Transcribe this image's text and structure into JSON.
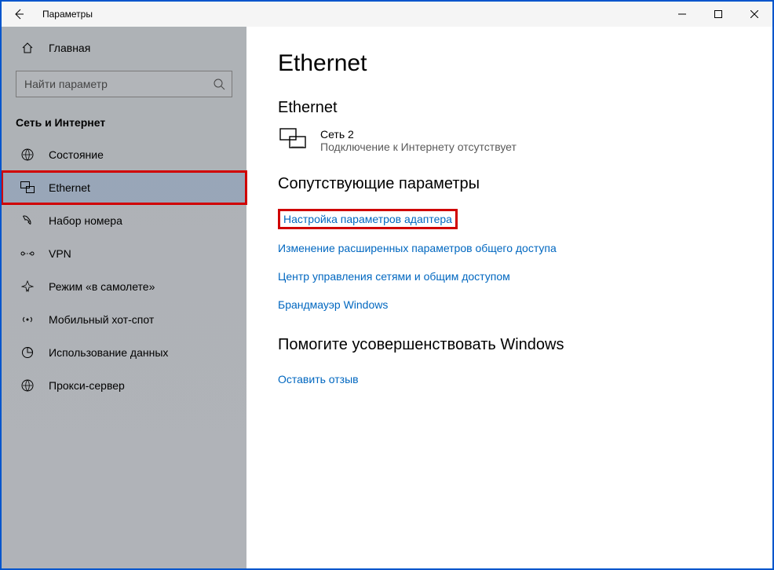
{
  "titlebar": {
    "title": "Параметры"
  },
  "sidebar": {
    "home": "Главная",
    "search_placeholder": "Найти параметр",
    "section": "Сеть и Интернет",
    "items": [
      {
        "label": "Состояние"
      },
      {
        "label": "Ethernet"
      },
      {
        "label": "Набор номера"
      },
      {
        "label": "VPN"
      },
      {
        "label": "Режим «в самолете»"
      },
      {
        "label": "Мобильный хот-спот"
      },
      {
        "label": "Использование данных"
      },
      {
        "label": "Прокси-сервер"
      }
    ]
  },
  "main": {
    "title": "Ethernet",
    "subheading": "Ethernet",
    "network": {
      "name": "Сеть 2",
      "status": "Подключение к Интернету отсутствует"
    },
    "related_heading": "Сопутствующие параметры",
    "links": [
      "Настройка параметров адаптера",
      "Изменение расширенных параметров общего доступа",
      "Центр управления сетями и общим доступом",
      "Брандмауэр Windows"
    ],
    "feedback_heading": "Помогите усовершенствовать Windows",
    "feedback_link": "Оставить отзыв"
  }
}
